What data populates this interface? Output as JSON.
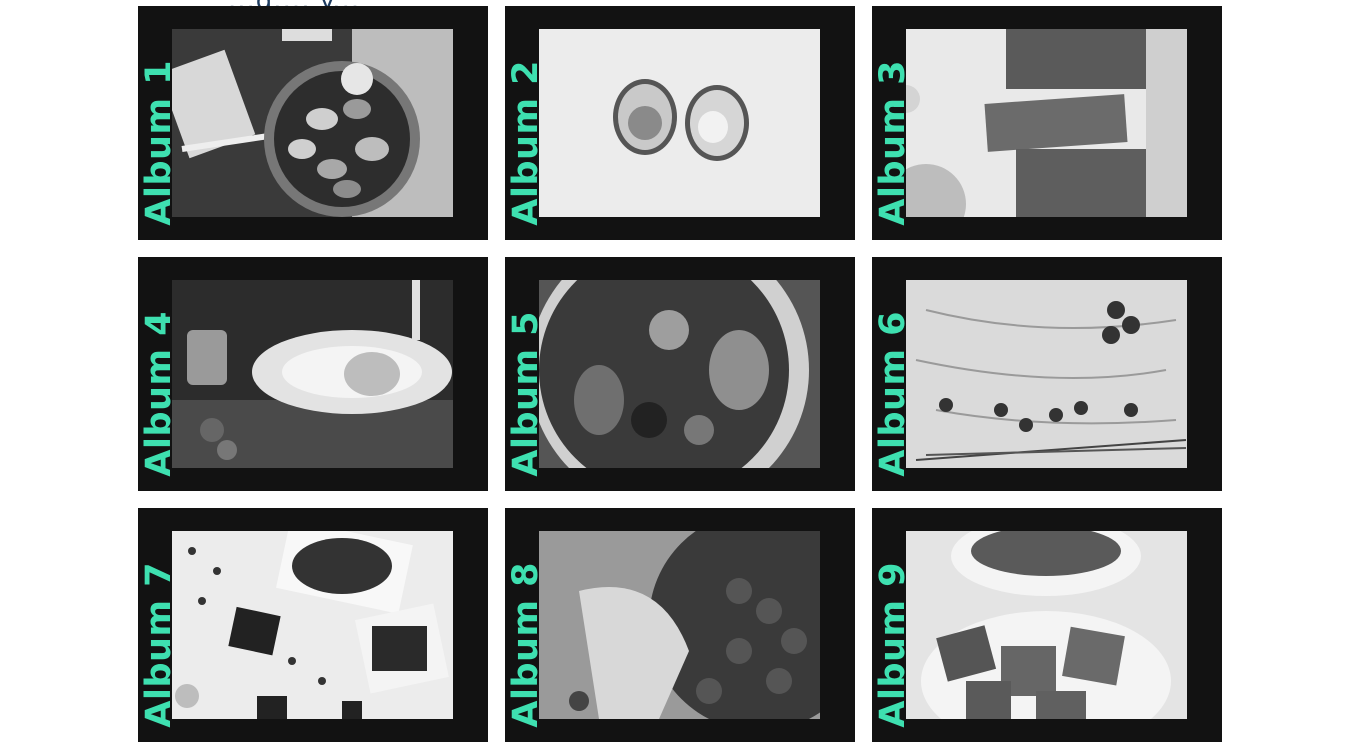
{
  "page": {
    "top_partial_text": "...g..., y...",
    "accent_color": "#3ee0b0",
    "card_background": "#121212"
  },
  "albums": [
    {
      "label": "Album 1",
      "photo": "clams-pan-photo"
    },
    {
      "label": "Album 2",
      "photo": "avocado-photo"
    },
    {
      "label": "Album 3",
      "photo": "bread-loaf-photo"
    },
    {
      "label": "Album 4",
      "photo": "dessert-plate-photo"
    },
    {
      "label": "Album 5",
      "photo": "salad-bowl-photo"
    },
    {
      "label": "Album 6",
      "photo": "berries-board-photo"
    },
    {
      "label": "Album 7",
      "photo": "coffee-chocolate-photo"
    },
    {
      "label": "Album 8",
      "photo": "cherries-bag-photo"
    },
    {
      "label": "Album 9",
      "photo": "watermelon-bowl-photo"
    }
  ]
}
